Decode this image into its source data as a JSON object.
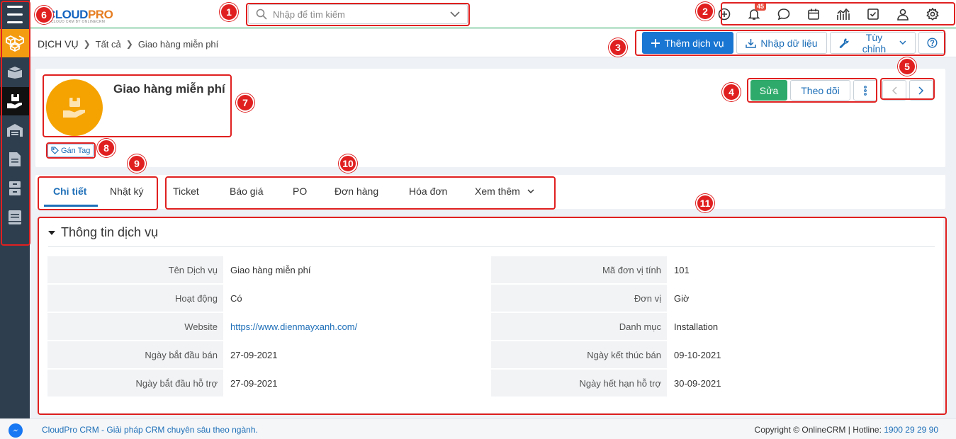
{
  "app": {
    "logo_main": "CLOUD",
    "logo_accent": "PRO",
    "logo_sub": "CLOUD CRM BY ONLINECRM"
  },
  "search": {
    "placeholder": "Nhập để tìm kiếm"
  },
  "notifications": {
    "count": "45"
  },
  "top_icons": [
    "add-circle-icon",
    "bell-icon",
    "chat-icon",
    "calendar-icon",
    "chart-icon",
    "checkbox-icon",
    "user-icon",
    "gear-icon"
  ],
  "breadcrumb": {
    "root": "DỊCH VỤ",
    "level1": "Tất cả",
    "current": "Giao hàng miễn phí"
  },
  "toolbar": {
    "add_label": "Thêm dịch vụ",
    "import_label": "Nhập dữ liệu",
    "customize_label": "Tùy chỉnh"
  },
  "record": {
    "title": "Giao hàng miễn phí",
    "tag_label": "Gán Tag",
    "edit_label": "Sửa",
    "follow_label": "Theo dõi"
  },
  "tabs": {
    "detail": "Chi tiết",
    "log": "Nhật ký"
  },
  "related_tabs": {
    "ticket": "Ticket",
    "quote": "Báo giá",
    "po": "PO",
    "order": "Đơn hàng",
    "invoice": "Hóa đơn",
    "more": "Xem thêm"
  },
  "section": {
    "title": "Thông tin dịch vụ"
  },
  "fields_left": [
    {
      "label": "Tên Dịch vụ",
      "value": "Giao hàng miễn phí"
    },
    {
      "label": "Hoạt động",
      "value": "Có"
    },
    {
      "label": "Website",
      "value": "https://www.dienmayxanh.com/"
    },
    {
      "label": "Ngày bắt đầu bán",
      "value": "27-09-2021"
    },
    {
      "label": "Ngày bắt đầu hỗ trợ",
      "value": "27-09-2021"
    }
  ],
  "fields_right": [
    {
      "label": "Mã đơn vị tính",
      "value": "101"
    },
    {
      "label": "Đơn vị",
      "value": "Giờ"
    },
    {
      "label": "Danh mục",
      "value": "Installation"
    },
    {
      "label": "Ngày kết thúc bán",
      "value": "09-10-2021"
    },
    {
      "label": "Ngày hết hạn hỗ trợ",
      "value": "30-09-2021"
    }
  ],
  "footer": {
    "left_text": "CloudPro CRM - Giải pháp CRM chuyên sâu theo ngành.",
    "copyright": "Copyright © OnlineCRM | Hotline: ",
    "hotline": "1900 29 29 90"
  },
  "annotations": [
    "1",
    "2",
    "3",
    "4",
    "5",
    "6",
    "7",
    "8",
    "9",
    "10",
    "11"
  ],
  "colors": {
    "accent": "#1976d2",
    "edit": "#2eaa6a",
    "annotation": "#e02020",
    "sidebar": "#2f3e4e",
    "avatar": "#f5a300"
  }
}
